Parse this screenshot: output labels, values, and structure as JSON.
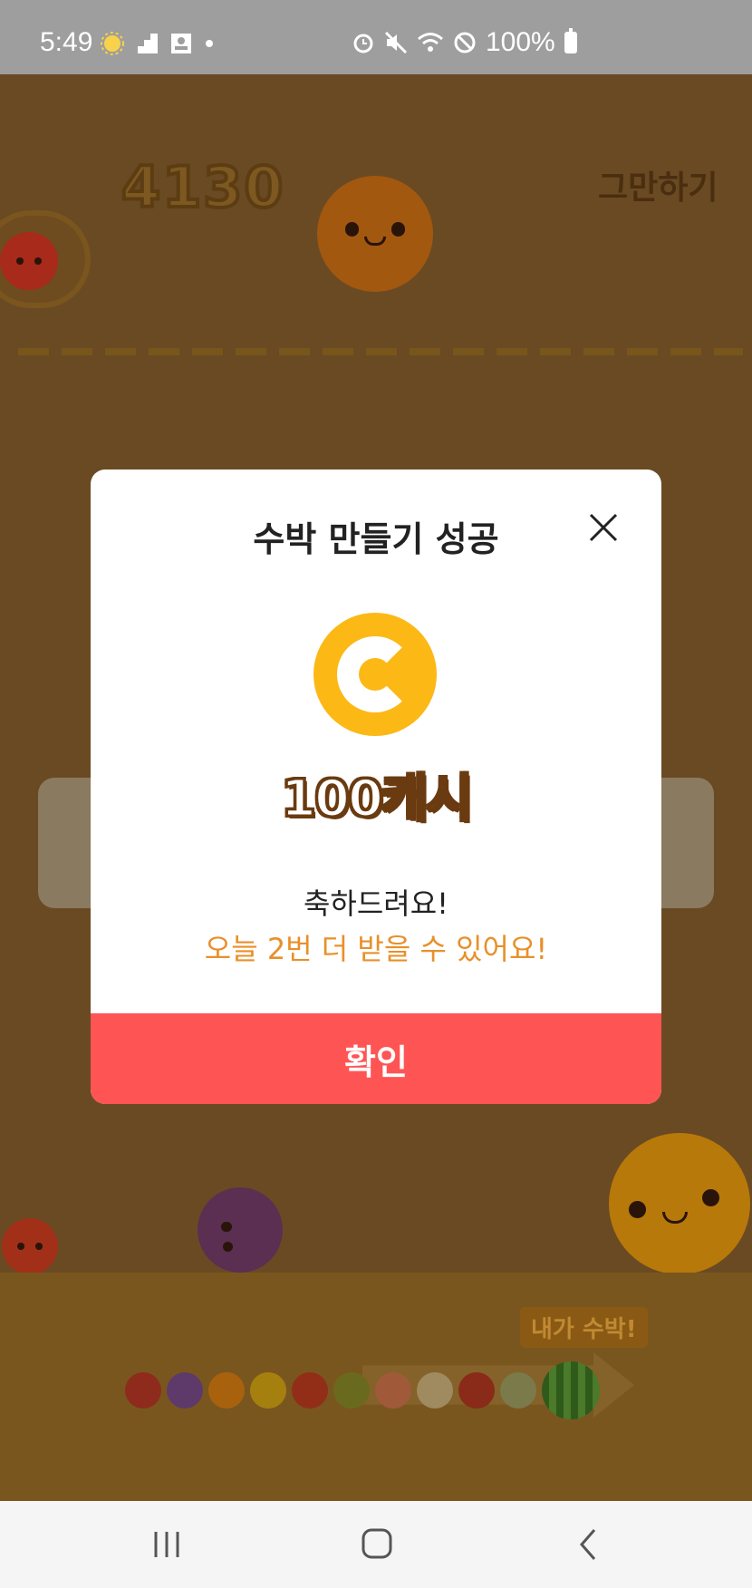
{
  "status_bar": {
    "time": "5:49",
    "battery": "100%",
    "icons": [
      "weather-sun-icon",
      "stairs-icon",
      "contact-card-icon",
      "dot-icon",
      "alarm-icon",
      "mute-icon",
      "wifi-icon",
      "dnd-icon",
      "battery-icon"
    ]
  },
  "game": {
    "score": "4130",
    "quit_label": "그만하기",
    "my_watermelon_badge": "내가 수박!"
  },
  "modal": {
    "title": "수박 만들기 성공",
    "reward_amount": "100캐시",
    "message_1": "축하드려요!",
    "message_2": "오늘 2번 더 받을 수 있어요!",
    "confirm_label": "확인"
  },
  "colors": {
    "overlay_bg": "#6a4a23",
    "coin": "#fcb814",
    "confirm": "#ff5454",
    "highlight_text": "#e8902a"
  },
  "nav_bar": {
    "buttons": [
      "recent-apps-icon",
      "home-icon",
      "back-icon"
    ]
  }
}
